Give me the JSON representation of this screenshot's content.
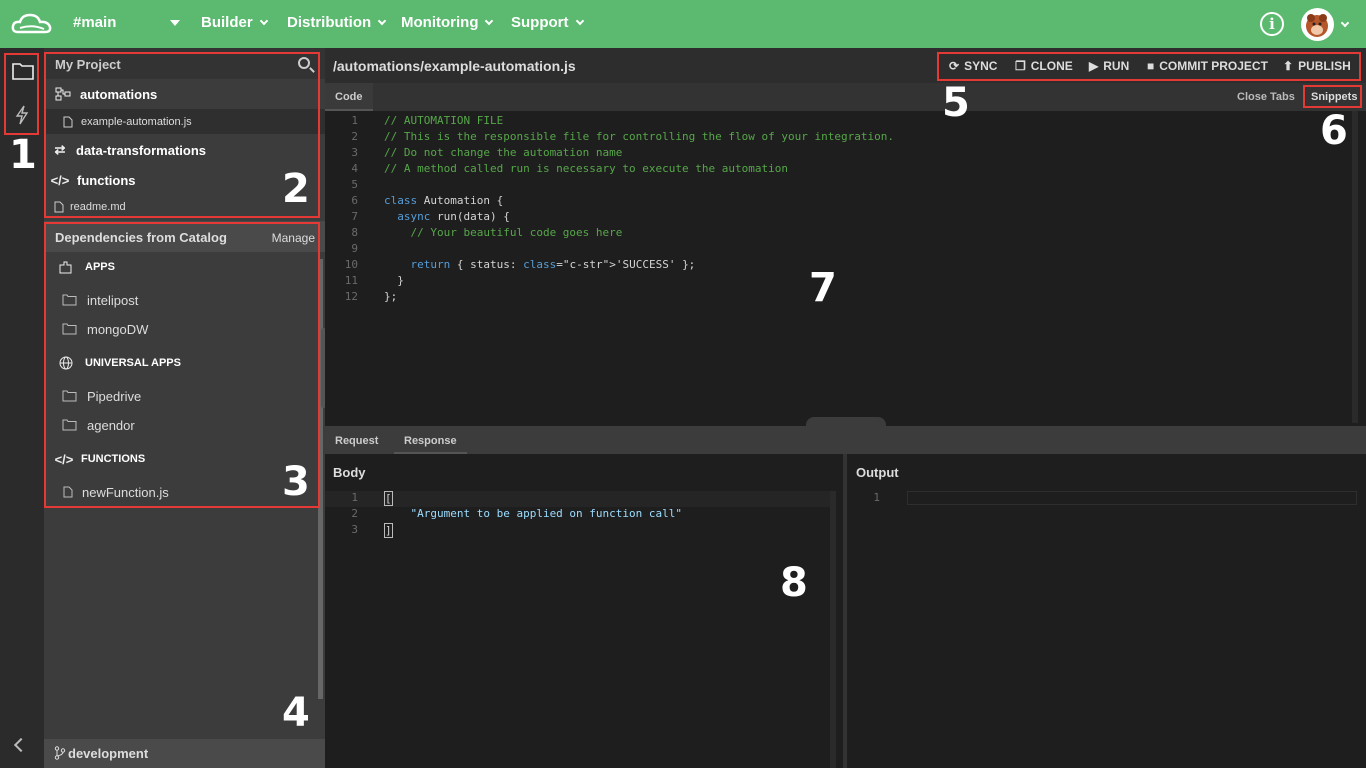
{
  "header": {
    "branch": "#main",
    "nav": [
      "Builder",
      "Distribution",
      "Monitoring",
      "Support"
    ],
    "colors": {
      "brand": "#5bba6f"
    }
  },
  "sidebar": {
    "project_title": "My Project",
    "tree": [
      {
        "label": "automations",
        "icon": "flow-icon",
        "bold": true
      },
      {
        "label": "example-automation.js",
        "icon": "file-icon",
        "bold": false
      },
      {
        "label": "data-transformations",
        "icon": "swap-icon",
        "bold": true
      },
      {
        "label": "functions",
        "icon": "code-icon",
        "bold": true
      },
      {
        "label": "readme.md",
        "icon": "file-icon",
        "bold": false
      }
    ],
    "deps_title": "Dependencies from Catalog",
    "manage_label": "Manage",
    "apps_label": "APPS",
    "apps": [
      "intelipost",
      "mongoDW"
    ],
    "universal_label": "UNIVERSAL APPS",
    "universal": [
      "Pipedrive",
      "agendor"
    ],
    "functions_label": "FUNCTIONS",
    "functions": [
      "newFunction.js"
    ],
    "branch": "development"
  },
  "editor": {
    "path": "/automations/example-automation.js",
    "toolbar": {
      "sync": "SYNC",
      "clone": "CLONE",
      "run": "RUN",
      "commit": "COMMIT PROJECT",
      "publish": "PUBLISH"
    },
    "tab": "Code",
    "close_tabs": "Close Tabs",
    "snippets": "Snippets",
    "lines": [
      "// AUTOMATION FILE",
      "// This is the responsible file for controlling the flow of your integration.",
      "// Do not change the automation name",
      "// A method called run is necessary to execute the automation",
      "",
      "class Automation {",
      "  async run(data) {",
      "    // Your beautiful code goes here",
      "",
      "    return { status: 'SUCCESS' };",
      "  }",
      "};"
    ]
  },
  "runner": {
    "tabs": [
      "Request",
      "Response"
    ],
    "body_title": "Body",
    "output_title": "Output",
    "body_lines": [
      "[",
      "    \"Argument to be applied on function call\"",
      "]"
    ]
  },
  "annotations": [
    "1",
    "2",
    "3",
    "4",
    "5",
    "6",
    "7",
    "8"
  ]
}
